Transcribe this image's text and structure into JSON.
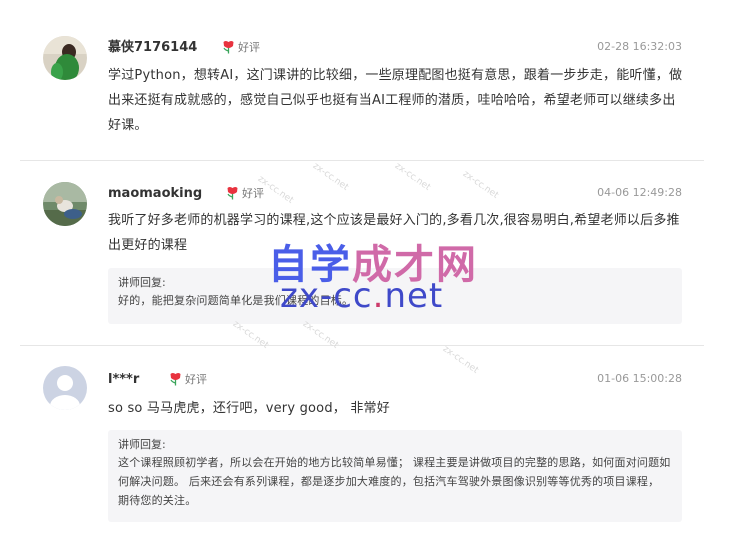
{
  "reviews": [
    {
      "username": "慕侠7176144",
      "rating": "好评",
      "time": "02-28 16:32:03",
      "content": "学过Python，想转AI，这门课讲的比较细，一些原理配图也挺有意思，跟着一步步走，能听懂，做出来还挺有成就感的，感觉自己似乎也挺有当AI工程师的潜质，哇哈哈哈，希望老师可以继续多出好课。"
    },
    {
      "username": "maomaoking",
      "rating": "好评",
      "time": "04-06 12:49:28",
      "content": "我听了好多老师的机器学习的课程,这个应该是最好入门的,多看几次,很容易明白,希望老师以后多推出更好的课程",
      "reply_label": "讲师回复:",
      "reply_text": "好的，能把复杂问题简单化是我们课程的目标。"
    },
    {
      "username": "l***r",
      "rating": "好评",
      "time": "01-06 15:00:28",
      "content": "so so 马马虎虎，还行吧，very good， 非常好",
      "reply_label": "讲师回复:",
      "reply_text": "这个课程照顾初学者，所以会在开始的地方比较简单易懂； 课程主要是讲做项目的完整的思路，如何面对问题如何解决问题。 后来还会有系列课程，都是逐步加大难度的，包括汽车驾驶外景图像识别等等优秀的项目课程， 期待您的关注。"
    }
  ],
  "watermark": {
    "cn_a": "自学",
    "cn_b": "成才网",
    "en_a": "zx-cc",
    "en_dot": ".",
    "en_b": "net",
    "faint": "zx-cc.net"
  },
  "colors": {
    "flower_red": "#e8333f",
    "flower_green": "#3aa55b",
    "watermark_blue": "#4a5ee8",
    "watermark_pink": "#d06aa8"
  }
}
